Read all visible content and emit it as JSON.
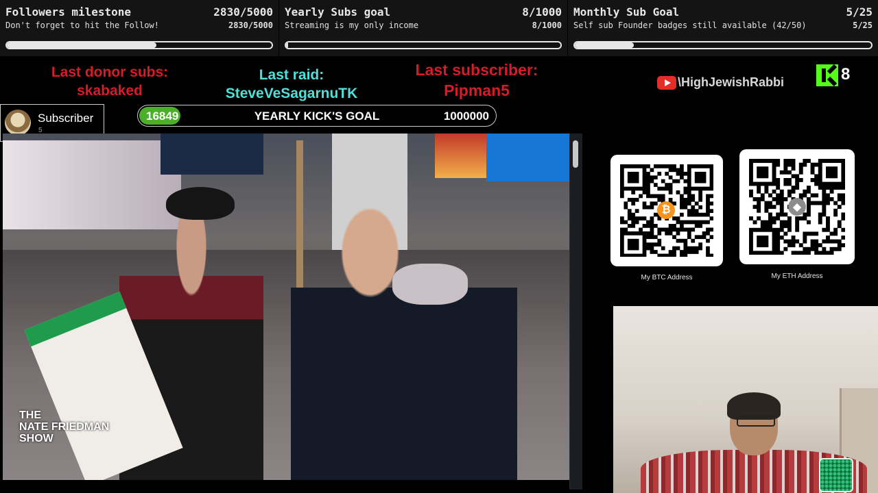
{
  "goals": [
    {
      "title": "Followers milestone",
      "count": "2830/5000",
      "subtitle": "Don't forget to hit the Follow!",
      "count_small": "2830/5000",
      "progress": 0.566
    },
    {
      "title": "Yearly Subs goal",
      "count": "8/1000",
      "subtitle": "Streaming is my only income",
      "count_small": "8/1000",
      "progress": 0.008
    },
    {
      "title": "Monthly Sub Goal",
      "count": "5/25",
      "subtitle": "Self sub Founder badges still available (42/50)",
      "count_small": "5/25",
      "progress": 0.2
    }
  ],
  "alerts": {
    "donor": {
      "label": "Last donor subs:",
      "name": "skabaked",
      "color": "#d51d2a"
    },
    "raid": {
      "label": "Last raid:",
      "name": "SteveVeSagarnuTK",
      "color": "#4ee0d9"
    },
    "subscriber": {
      "label": "Last subscriber:",
      "name": "Pipman5",
      "color": "#d51d2a"
    }
  },
  "socials": {
    "youtube_icon": "youtube-icon",
    "youtube_name": "\\HighJewishRabbi",
    "kick_icon": "kick-icon",
    "kick_count": "8",
    "kick_color": "#53fc18"
  },
  "subscriber_widget": {
    "label": "Subscriber",
    "count": "5"
  },
  "kick_goal": {
    "current": "16849",
    "title": "YEARLY KICK'S GOAL",
    "target": "1000000",
    "progress": 0.016849
  },
  "video": {
    "watermark": "THE\nNATE FRIEDMAN\nSHOW"
  },
  "donations": [
    {
      "caption": "My BTC Address",
      "coin_icon": "bitcoin-icon",
      "coin_color": "#f7931a",
      "coin_glyph": "₿"
    },
    {
      "caption": "My ETH Address",
      "coin_icon": "ethereum-icon",
      "coin_color": "#8c8c8c",
      "coin_glyph": "◆"
    }
  ]
}
